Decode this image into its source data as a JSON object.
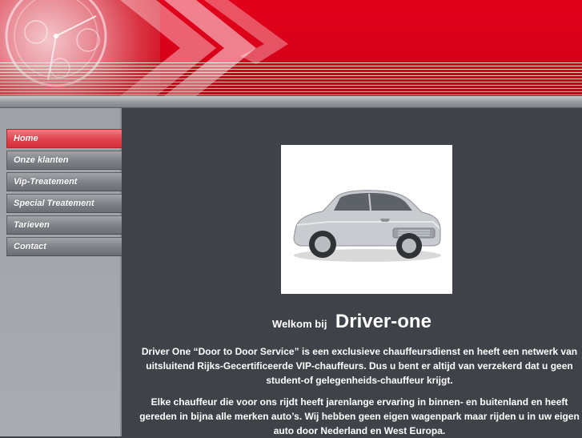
{
  "nav": {
    "items": [
      {
        "label": "Home",
        "active": true
      },
      {
        "label": "Onze klanten",
        "active": false
      },
      {
        "label": "Vip-Treatement",
        "active": false
      },
      {
        "label": "Special Treatement",
        "active": false
      },
      {
        "label": "Tarieven",
        "active": false
      },
      {
        "label": "Contact",
        "active": false
      }
    ]
  },
  "main": {
    "welcome_prefix": "Welkom bij",
    "welcome_brand": "Driver-one",
    "paragraph1": "Driver One “Door to Door Service” is een exclusieve chauffeursdienst en heeft een netwerk van uitsluitend Rijks-Gecertificeerde VIP-chauffeurs. Dus u bent er altijd van verzekerd dat u geen student-of gelegenheids-chauffeur krijgt.",
    "paragraph2": "Elke chauffeur die voor ons rijdt heeft jarenlange ervaring in binnen- en buitenland en heeft gereden in bijna alle merken auto’s. Wij hebben geen eigen wagenpark maar rijden u in uw eigen auto door Nederland en West Europa."
  },
  "colors": {
    "brand_red": "#e2001a",
    "active_nav": "#e0444d",
    "content_bg": "#3f4248",
    "sidebar_bg": "#a6a9ae"
  }
}
